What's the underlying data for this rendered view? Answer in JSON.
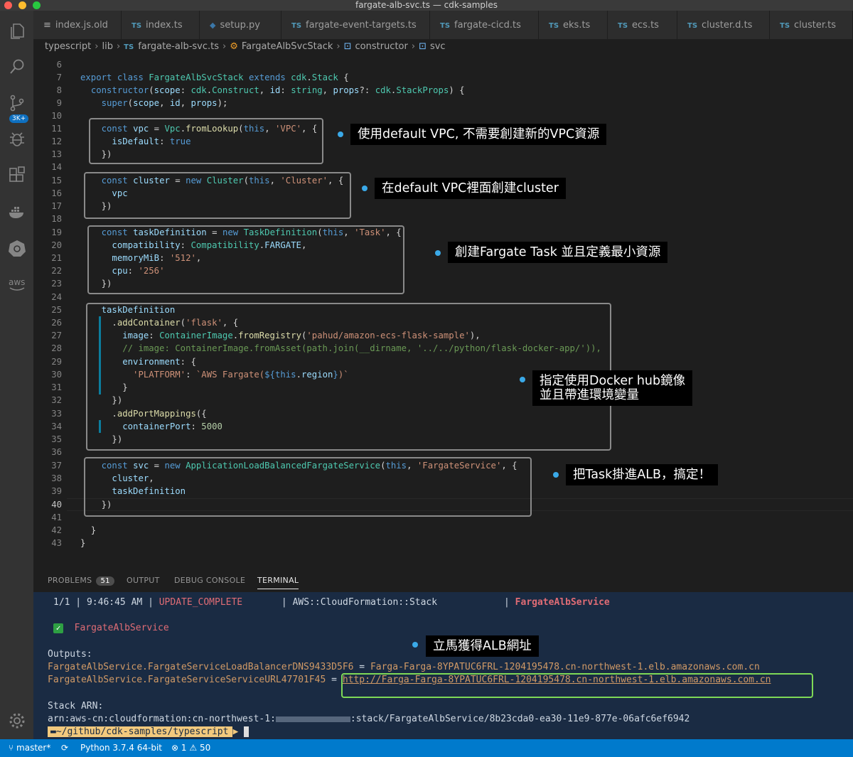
{
  "window": {
    "title": "fargate-alb-svc.ts — cdk-samples"
  },
  "activity_bar": {
    "scm_badge": "3K+"
  },
  "tabs": [
    {
      "icon": "≡",
      "label": "index.js.old"
    },
    {
      "icon": "TS",
      "label": "index.ts"
    },
    {
      "icon": "py",
      "label": "setup.py"
    },
    {
      "icon": "TS",
      "label": "fargate-event-targets.ts"
    },
    {
      "icon": "TS",
      "label": "fargate-cicd.ts"
    },
    {
      "icon": "TS",
      "label": "eks.ts"
    },
    {
      "icon": "TS",
      "label": "ecs.ts"
    },
    {
      "icon": "TS",
      "label": "cluster.d.ts"
    },
    {
      "icon": "TS",
      "label": "cluster.ts"
    }
  ],
  "breadcrumb": {
    "b1": "typescript",
    "b2": "lib",
    "b3": "fargate-alb-svc.ts",
    "b4": "FargateAlbSvcStack",
    "b5": "constructor",
    "b6": "svc"
  },
  "editor": {
    "line_numbers": [
      "6",
      "7",
      "8",
      "9",
      "10",
      "11",
      "12",
      "13",
      "14",
      "15",
      "16",
      "17",
      "18",
      "19",
      "20",
      "21",
      "22",
      "23",
      "24",
      "25",
      "26",
      "27",
      "28",
      "29",
      "30",
      "31",
      "32",
      "33",
      "34",
      "35",
      "36",
      "37",
      "38",
      "39",
      "40",
      "41",
      "42",
      "43"
    ],
    "current_line": "40"
  },
  "annotations": {
    "a1": "使用default VPC, 不需要創建新的VPC資源",
    "a2": "在default VPC裡面創建cluster",
    "a3": "創建Fargate Task 並且定義最小資源",
    "a4_line1": "指定使用Docker hub鏡像",
    "a4_line2": "並且帶進環境變量",
    "a5": "把Task掛進ALB，搞定！",
    "a6": "立馬獲得ALB網址"
  },
  "panel": {
    "tabs": {
      "problems": "PROBLEMS",
      "problems_count": "51",
      "output": "OUTPUT",
      "debug": "DEBUG CONSOLE",
      "terminal": "TERMINAL"
    }
  },
  "terminal": {
    "progress": "1/1",
    "time": "9:46:45 AM",
    "status": "UPDATE_COMPLETE",
    "resource_type": "AWS::CloudFormation::Stack",
    "stack": "FargateAlbService",
    "done_stack": "FargateAlbService",
    "outputs_label": "Outputs:",
    "out1_key": "FargateAlbService.FargateServiceLoadBalancerDNS9433D5F6",
    "out1_val": "Farga-Farga-8YPATUC6FRL-1204195478.cn-northwest-1.elb.amazonaws.com.cn",
    "out2_key": "FargateAlbService.FargateServiceServiceURL47701F45",
    "out2_val": "http://Farga-Farga-8YPATUC6FRL-1204195478.cn-northwest-1.elb.amazonaws.com.cn",
    "arn_label": "Stack ARN:",
    "arn_prefix": "arn:aws-cn:cloudformation:cn-northwest-1:",
    "arn_suffix": ":stack/FargateAlbService/8b23cda0-ea30-11e9-877e-06afc6ef6942",
    "prompt": "~/github/cdk-samples/typescript"
  },
  "statusbar": {
    "branch": "master*",
    "python": "Python 3.7.4 64-bit",
    "errors": "1",
    "warnings": "50"
  },
  "colors": {
    "accent": "#007acc",
    "highlight_box": "#7ed957",
    "annotation_dot": "#3aa9e8"
  }
}
